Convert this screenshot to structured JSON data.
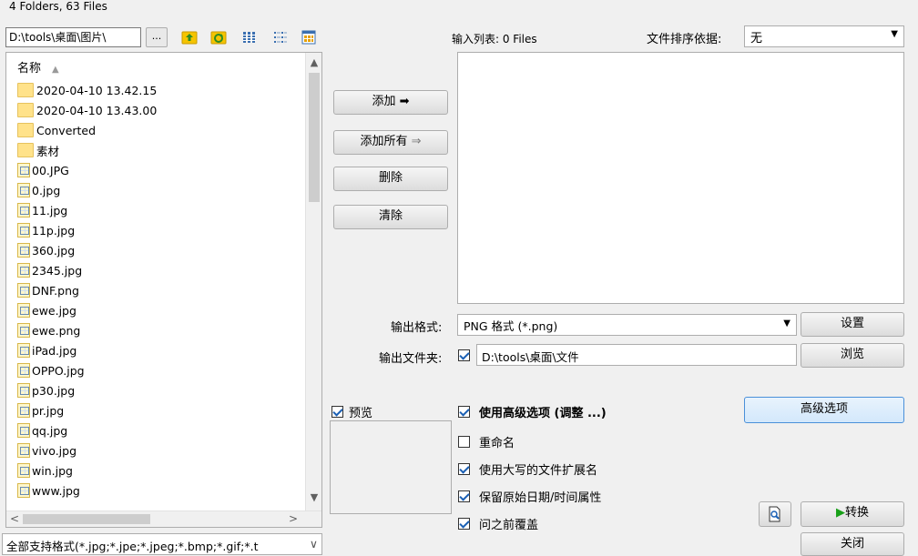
{
  "status": {
    "summary": "4 Folders, 63 Files"
  },
  "browser": {
    "path": "D:\\tools\\桌面\\图片\\",
    "browse_label": "...",
    "column_header": "名称",
    "items": [
      {
        "type": "folder",
        "name": "2020-04-10 13.42.15"
      },
      {
        "type": "folder",
        "name": "2020-04-10 13.43.00"
      },
      {
        "type": "folder",
        "name": "Converted"
      },
      {
        "type": "folder",
        "name": "素材"
      },
      {
        "type": "image",
        "name": "00.JPG"
      },
      {
        "type": "image",
        "name": "0.jpg"
      },
      {
        "type": "image",
        "name": "11.jpg"
      },
      {
        "type": "image",
        "name": "11p.jpg"
      },
      {
        "type": "image",
        "name": "360.jpg"
      },
      {
        "type": "image",
        "name": "2345.jpg"
      },
      {
        "type": "image",
        "name": "DNF.png"
      },
      {
        "type": "image",
        "name": "ewe.jpg"
      },
      {
        "type": "image",
        "name": "ewe.png"
      },
      {
        "type": "image",
        "name": "iPad.jpg"
      },
      {
        "type": "image",
        "name": "OPPO.jpg"
      },
      {
        "type": "image",
        "name": "p30.jpg"
      },
      {
        "type": "image",
        "name": "pr.jpg"
      },
      {
        "type": "image",
        "name": "qq.jpg"
      },
      {
        "type": "image",
        "name": "vivo.jpg"
      },
      {
        "type": "image",
        "name": "win.jpg"
      },
      {
        "type": "image",
        "name": "www.jpg"
      }
    ],
    "filter": "全部支持格式(*.jpg;*.jpe;*.jpeg;*.bmp;*.gif;*.t"
  },
  "actions": {
    "add": "添加",
    "add_all": "添加所有",
    "delete": "删除",
    "clear": "清除"
  },
  "input_list": {
    "label": "输入列表: 0 Files",
    "sort_label": "文件排序依据:",
    "sort_value": "无"
  },
  "output": {
    "format_label": "输出格式:",
    "format_value": "PNG 格式  (*.png)",
    "settings_button": "设置",
    "folder_label": "输出文件夹:",
    "folder_checked": true,
    "folder_value": "D:\\tools\\桌面\\文件",
    "browse_button": "浏览"
  },
  "options": {
    "preview": {
      "label": "预览",
      "checked": true
    },
    "advanced": {
      "label": "使用高级选项 (调整 ...)",
      "checked": true
    },
    "rename": {
      "label": "重命名",
      "checked": false
    },
    "uppercase_ext": {
      "label": "使用大写的文件扩展名",
      "checked": true
    },
    "keep_date": {
      "label": "保留原始日期/时间属性",
      "checked": true
    },
    "ask_overwrite": {
      "label": "问之前覆盖",
      "checked": true
    }
  },
  "buttons": {
    "advanced_options": "高级选项",
    "convert": "转换",
    "close": "关闭"
  },
  "colors": {
    "accent": "#4a90d9",
    "folder": "#ffe28a",
    "convert_arrow": "#18a018"
  }
}
